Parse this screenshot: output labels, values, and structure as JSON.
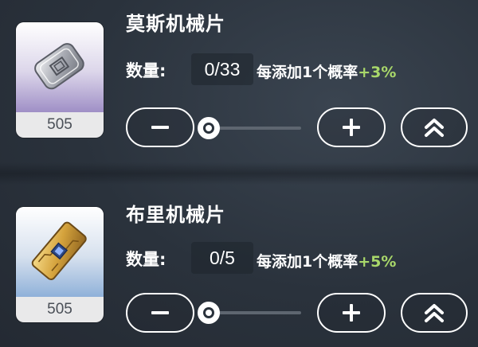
{
  "items": [
    {
      "name": "莫斯机械片",
      "count_badge": "505",
      "qty_label": "数量:",
      "qty_value": "0/33",
      "rate_text": "每添加1个概率",
      "rate_bonus": "+3%",
      "icon": "silver-mechanical-chip-icon",
      "card_gradient": [
        "#ffffff",
        "#9f8fc6"
      ]
    },
    {
      "name": "布里机械片",
      "count_badge": "505",
      "qty_label": "数量:",
      "qty_value": "0/5",
      "rate_text": "每添加1个概率",
      "rate_bonus": "+5%",
      "icon": "gold-mechanical-chip-icon",
      "card_gradient": [
        "#ffffff",
        "#8fb1d9"
      ]
    }
  ],
  "colors": {
    "bonus": "#a9d86a",
    "text": "#ffffff",
    "background": "#2a323c"
  },
  "controls": {
    "minus_icon": "minus-icon",
    "plus_icon": "plus-icon",
    "max_icon": "double-chevron-up-icon",
    "slider_level": 0
  }
}
